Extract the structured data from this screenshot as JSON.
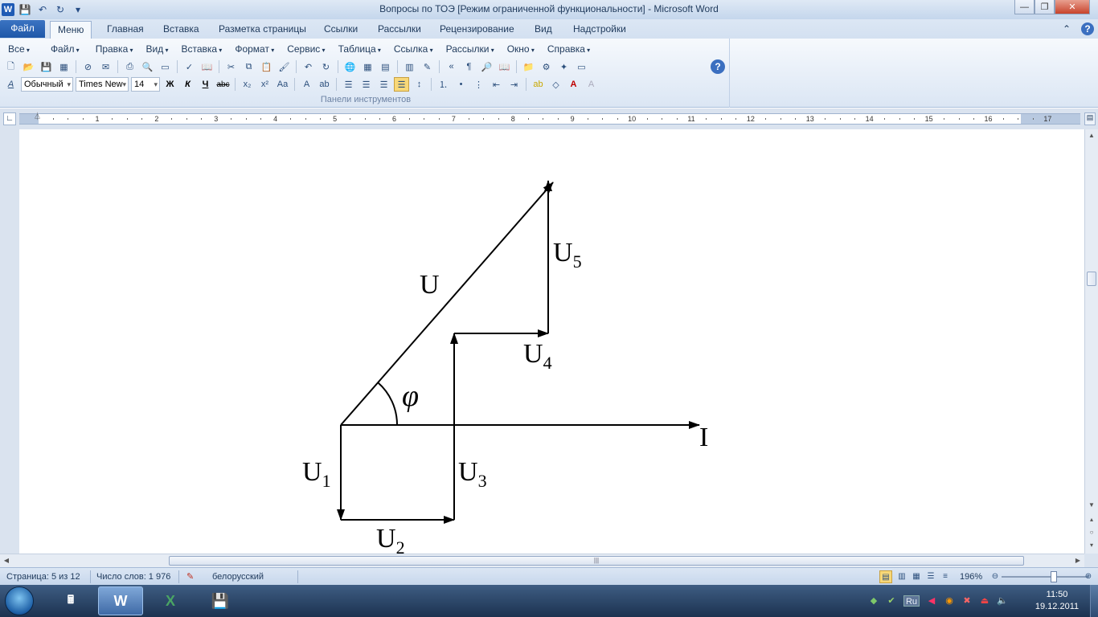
{
  "window": {
    "title": "Вопросы по ТОЭ [Режим ограниченной функциональности]  -  Microsoft Word"
  },
  "quick_access": {
    "app_icon": "W"
  },
  "ribbon": {
    "tabs": [
      "Файл",
      "Меню",
      "Главная",
      "Вставка",
      "Разметка страницы",
      "Ссылки",
      "Рассылки",
      "Рецензирование",
      "Вид",
      "Надстройки"
    ],
    "menu_items": [
      "Все",
      "Файл",
      "Правка",
      "Вид",
      "Вставка",
      "Формат",
      "Сервис",
      "Таблица",
      "Ссылка",
      "Рассылки",
      "Окно",
      "Справка"
    ],
    "style_combo": "Обычный",
    "font_combo": "Times New",
    "size_combo": "14",
    "bold": "Ж",
    "italic": "К",
    "underline": "Ч",
    "strike": "abc",
    "group_label": "Панели инструментов",
    "help": "?"
  },
  "ruler": {
    "numbers": [
      "1",
      "2",
      "3",
      "4",
      "5",
      "6",
      "7",
      "8",
      "9",
      "10",
      "11",
      "12",
      "13",
      "14",
      "15",
      "16",
      "17"
    ]
  },
  "diagram": {
    "labels": {
      "U": "U",
      "U1": "U",
      "U1_sub": "1",
      "U2": "U",
      "U2_sub": "2",
      "U3": "U",
      "U3_sub": "3",
      "U4": "U",
      "U4_sub": "4",
      "U5": "U",
      "U5_sub": "5",
      "I": "I",
      "phi": "φ"
    }
  },
  "statusbar": {
    "page": "Страница: 5 из 12",
    "words": "Число слов: 1 976",
    "language": "белорусский",
    "zoom": "196%",
    "zoom_level": 0.6
  },
  "taskbar": {
    "clock_time": "11:50",
    "clock_date": "19.12.2011",
    "lang": "Ru"
  }
}
